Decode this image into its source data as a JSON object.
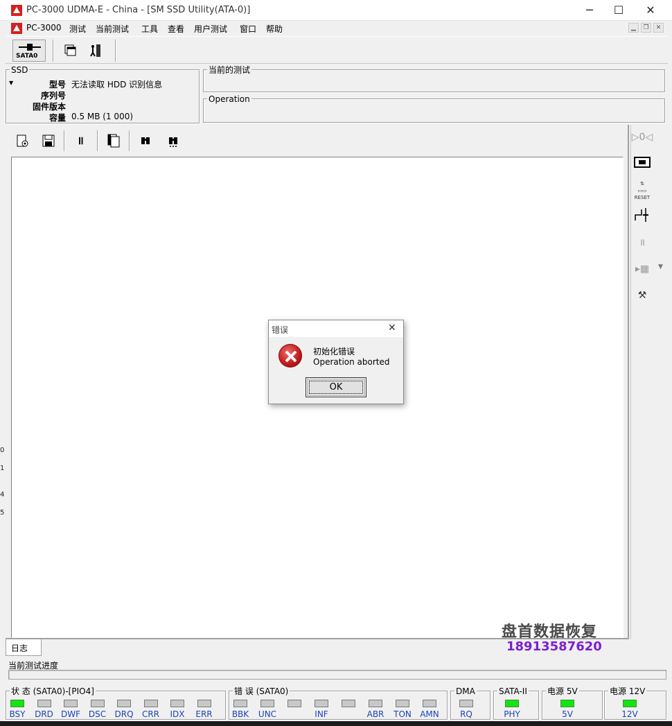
{
  "window": {
    "title": "PC-3000 UDMA-E - China - [SM SSD Utility(ATA-0)]",
    "minimize": "─",
    "maximize": "☐",
    "close": "✕"
  },
  "menu": [
    "PC-3000",
    "测试",
    "当前测试",
    "工具",
    "查看",
    "用户测试",
    "窗口",
    "帮助"
  ],
  "toolbar1": {
    "sata_label": "SATA0"
  },
  "ssd_panel": {
    "group_label": "SSD",
    "fields": [
      {
        "label": "型号",
        "value": "无法读取 HDD 识别信息"
      },
      {
        "label": "序列号",
        "value": ""
      },
      {
        "label": "固件版本",
        "value": ""
      },
      {
        "label": "容量",
        "value": "0.5 MB (1 000)"
      }
    ]
  },
  "current_test": {
    "label": "当前的测试"
  },
  "operation": {
    "label": "Operation"
  },
  "dialog": {
    "title": "错误",
    "line1": "初始化错误",
    "line2": "Operation aborted",
    "ok": "OK"
  },
  "log_tab": "日志",
  "progress_label": "当前测试进度",
  "status_groups": [
    {
      "label": "状 态 (SATA0)-[PIO4]",
      "leds": [
        {
          "name": "BSY",
          "on": true
        },
        {
          "name": "DRD",
          "on": false
        },
        {
          "name": "DWF",
          "on": false
        },
        {
          "name": "DSC",
          "on": false
        },
        {
          "name": "DRQ",
          "on": false
        },
        {
          "name": "CRR",
          "on": false
        },
        {
          "name": "IDX",
          "on": false
        },
        {
          "name": "ERR",
          "on": false
        }
      ]
    },
    {
      "label": "错 误 (SATA0)",
      "leds": [
        {
          "name": "BBK",
          "on": false
        },
        {
          "name": "UNC",
          "on": false
        },
        {
          "name": "",
          "on": false
        },
        {
          "name": "INF",
          "on": false
        },
        {
          "name": "",
          "on": false
        },
        {
          "name": "ABR",
          "on": false
        },
        {
          "name": "TON",
          "on": false
        },
        {
          "name": "AMN",
          "on": false
        }
      ]
    },
    {
      "label": "DMA",
      "leds": [
        {
          "name": "RQ",
          "on": false
        }
      ]
    },
    {
      "label": "SATA-II",
      "leds": [
        {
          "name": "PHY",
          "on": true
        }
      ]
    },
    {
      "label": "电源 5V",
      "leds": [
        {
          "name": "5V",
          "on": true
        }
      ]
    },
    {
      "label": "电源 12V",
      "leds": [
        {
          "name": "12V",
          "on": true
        }
      ]
    }
  ],
  "watermark": {
    "line1": "盘首数据恢复",
    "line2": "18913587620"
  },
  "left_edge_chars": [
    "0",
    "1",
    "4",
    "5"
  ],
  "colors": {
    "led_on": "#11e611",
    "led_off": "#c8c8c8",
    "led_label": "#1a43b5",
    "watermark_phone": "#7a1fd0"
  }
}
